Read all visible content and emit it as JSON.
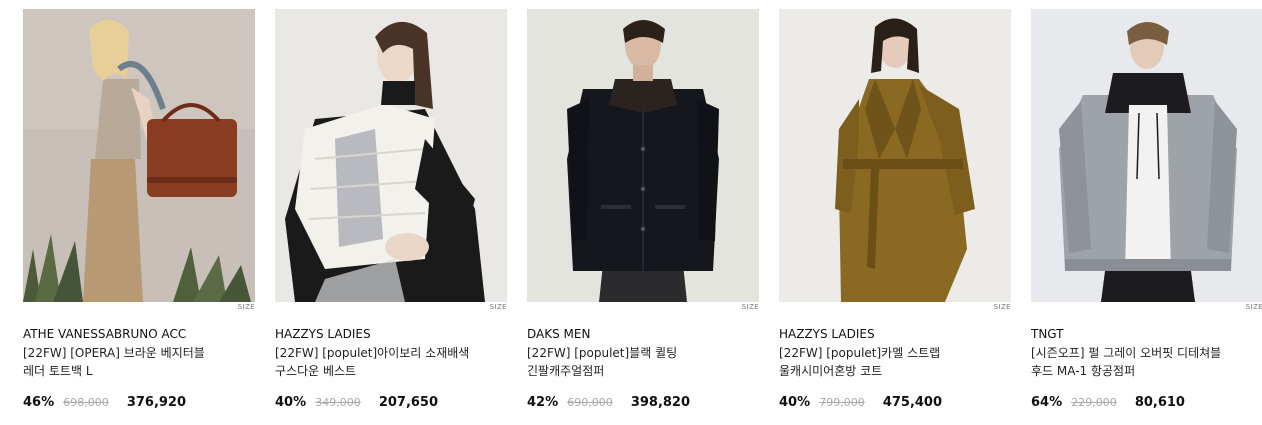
{
  "products": [
    {
      "brand": "ATHE VANESSABRUNO ACC",
      "name": "[22FW] [OPERA] 브라운 베지터블 레더 토트백 L",
      "discount": "46%",
      "original_price": "698,000",
      "sale_price": "376,920",
      "size_label": "SIZE",
      "image_desc": "model-with-brown-tote-bag"
    },
    {
      "brand": "HAZZYS LADIES",
      "name": "[22FW] [populet]아이보리 소재배색 구스다운 베스트",
      "discount": "40%",
      "original_price": "349,000",
      "sale_price": "207,650",
      "size_label": "SIZE",
      "image_desc": "model-in-ivory-down-vest"
    },
    {
      "brand": "DAKS MEN",
      "name": "[22FW] [populet]블랙 퀼팅 긴팔캐주얼점퍼",
      "discount": "42%",
      "original_price": "690,000",
      "sale_price": "398,820",
      "size_label": "SIZE",
      "image_desc": "model-in-black-quilted-jacket"
    },
    {
      "brand": "HAZZYS LADIES",
      "name": "[22FW] [populet]카멜 스트랩 울캐시미어혼방 코트",
      "discount": "40%",
      "original_price": "799,000",
      "sale_price": "475,400",
      "size_label": "SIZE",
      "image_desc": "model-in-camel-wool-coat"
    },
    {
      "brand": "TNGT",
      "name": "[시즌오프] 펄 그레이 오버핏 디테쳐블 후드 MA-1 항공점퍼",
      "discount": "64%",
      "original_price": "229,000",
      "sale_price": "80,610",
      "size_label": "SIZE",
      "image_desc": "model-in-grey-ma1-bomber"
    }
  ]
}
